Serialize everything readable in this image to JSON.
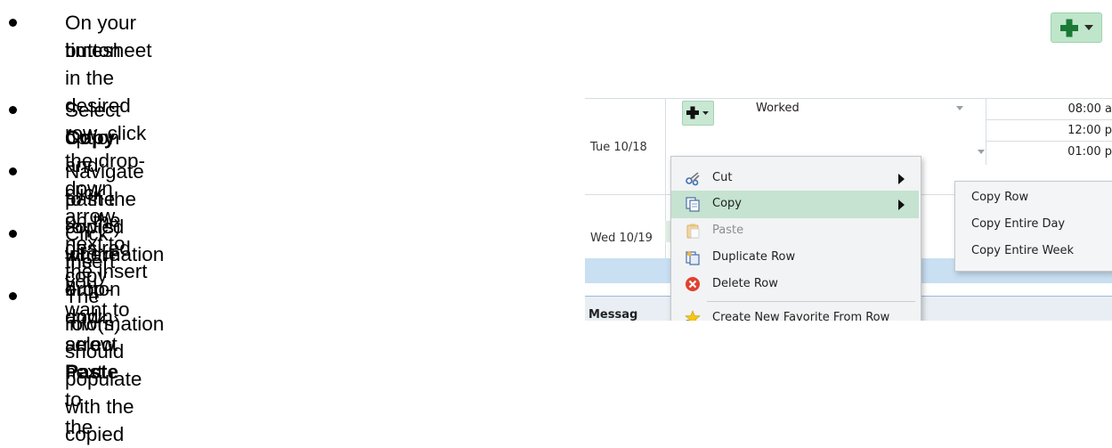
{
  "instructions": [
    {
      "text": " On your timesheet in the desired row, click the drop-down arrow next to the insert",
      "text2": "button"
    },
    {
      "pre": "Select ",
      "bold": "Copy",
      "post": " and click on the desired copy",
      "text2": "option"
    },
    {
      "text": "Navigate to the row(s) where you want to",
      "text2": "past the copied information"
    },
    {
      "text": "Click the drop-down arrow next to the",
      "text2pre": "Insert button and select ",
      "bold": "Paste"
    },
    {
      "text": "The row(s) should populate with the copied",
      "text2": "information"
    }
  ],
  "timesheet": {
    "rows": [
      {
        "day": "Tue 10/18",
        "type": "Worked",
        "times": [
          "08:00 a",
          "12:00 p",
          "01:00 p"
        ]
      },
      {
        "day": "Wed 10/19"
      }
    ],
    "bottom_partial_label": "Messag"
  },
  "context_menu": {
    "items": [
      {
        "label": "Cut",
        "icon": "scissors-icon",
        "submenu": true
      },
      {
        "label": "Copy",
        "icon": "copy-icon",
        "submenu": true,
        "selected": true
      },
      {
        "label": "Paste",
        "icon": "paste-icon",
        "disabled": true
      },
      {
        "label": "Duplicate Row",
        "icon": "duplicate-icon"
      },
      {
        "label": "Delete Row",
        "icon": "delete-icon"
      },
      {
        "label": "Create New Favorite From Row",
        "icon": "favorite-star-icon"
      }
    ],
    "copy_submenu": [
      "Copy Row",
      "Copy Entire Day",
      "Copy Entire Week"
    ]
  },
  "colors": {
    "insert_green": "#1a7a35",
    "menu_selected": "#c5e3d0",
    "band_blue": "#c9dff2"
  }
}
